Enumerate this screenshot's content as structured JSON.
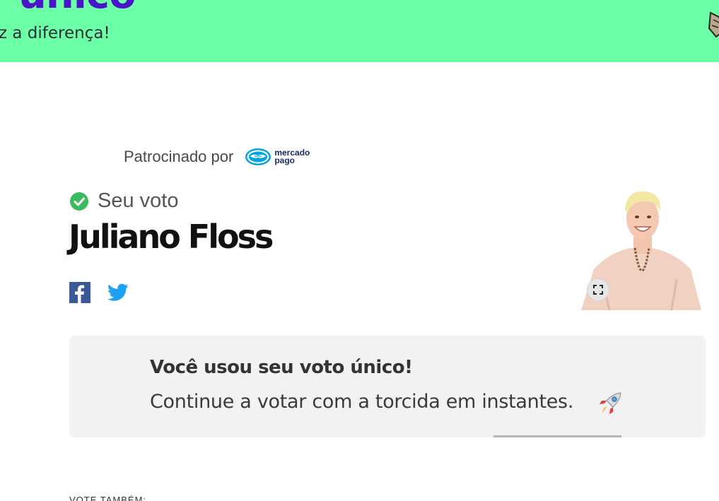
{
  "banner": {
    "title": "único",
    "subtitle": "z a diferença!"
  },
  "sponsor": {
    "label": "Patrocinado por",
    "logo_line1": "mercado",
    "logo_line2": "pago"
  },
  "vote": {
    "status_label": "Seu voto",
    "candidate_name": "Juliano Floss"
  },
  "notice": {
    "title": "Você usou seu voto único!",
    "message": "Continue a votar com a torcida em instantes."
  },
  "footer": {
    "vote_also": "VOTE TAMBÉM:"
  },
  "icons": {
    "check": "check-circle-icon",
    "facebook": "facebook-icon",
    "twitter": "twitter-icon",
    "expand": "expand-icon",
    "rocket": "rocket-icon"
  },
  "colors": {
    "banner_bg": "#6bffa6",
    "banner_title": "#4a14c9",
    "check_green": "#3dbb61",
    "facebook_blue": "#3b5998",
    "twitter_blue": "#1da1f2",
    "notice_bg": "#f2f2f2"
  }
}
